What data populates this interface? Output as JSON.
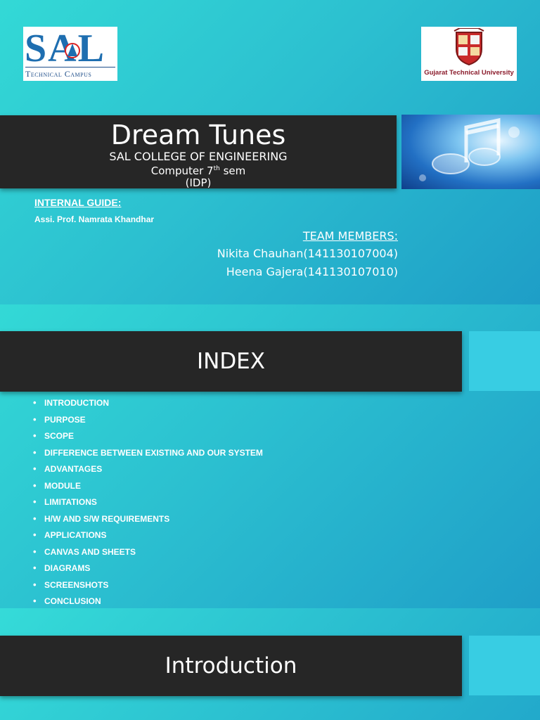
{
  "slide1": {
    "sal_logo": {
      "letters": "SAL",
      "subtitle": "Technical Campus"
    },
    "gtu_logo": {
      "caption": "Gujarat Technical University"
    },
    "title": "Dream Tunes",
    "college": "SAL COLLEGE OF ENGINEERING",
    "semester_prefix": "Computer 7",
    "semester_sup": "th",
    "semester_suffix": " sem",
    "project_type": "(IDP)",
    "internal_guide_label": "INTERNAL GUIDE:",
    "internal_guide_name": "Assi. Prof.  Namrata Khandhar",
    "team_label": "TEAM MEMBERS:",
    "team_members": [
      "Nikita Chauhan(141130107004)",
      "Heena Gajera(141130107010)"
    ]
  },
  "slide2": {
    "title": "INDEX",
    "items": [
      "INTRODUCTION",
      "PURPOSE",
      "SCOPE",
      "DIFFERENCE BETWEEN EXISTING AND OUR SYSTEM",
      "ADVANTAGES",
      "MODULE",
      "LIMITATIONS",
      "H/W AND S/W REQUIREMENTS",
      "APPLICATIONS",
      "CANVAS AND SHEETS",
      "DIAGRAMS",
      "SCREENSHOTS",
      "CONCLUSION"
    ]
  },
  "slide3": {
    "title": "Introduction"
  },
  "colors": {
    "banner": "#262626",
    "background": "#2fc6d2",
    "accent": "#38cde3"
  }
}
